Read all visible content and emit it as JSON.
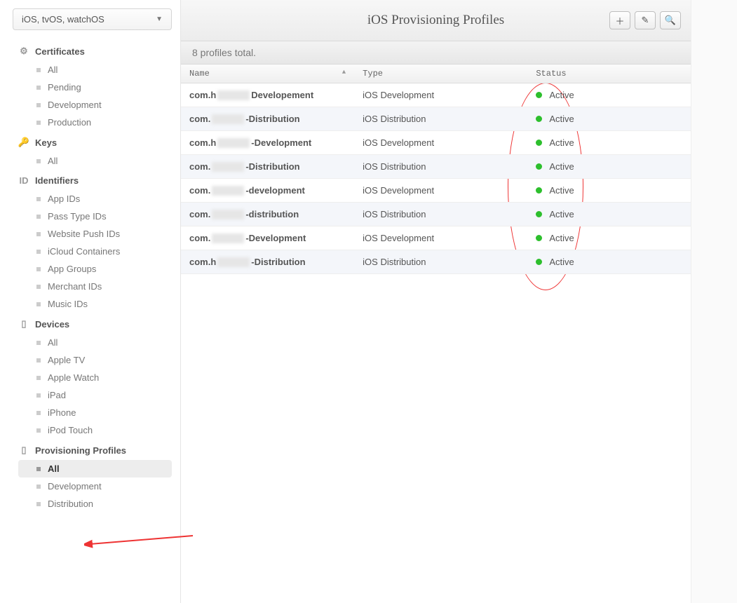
{
  "platform_selector": "iOS, tvOS, watchOS",
  "page_title": "iOS Provisioning Profiles",
  "summary": "8 profiles total.",
  "columns": {
    "name": "Name",
    "type": "Type",
    "status": "Status"
  },
  "sidebar": [
    {
      "title": "Certificates",
      "icon": "gear",
      "items": [
        "All",
        "Pending",
        "Development",
        "Production"
      ]
    },
    {
      "title": "Keys",
      "icon": "key",
      "items": [
        "All"
      ]
    },
    {
      "title": "Identifiers",
      "icon": "id",
      "items": [
        "App IDs",
        "Pass Type IDs",
        "Website Push IDs",
        "iCloud Containers",
        "App Groups",
        "Merchant IDs",
        "Music IDs"
      ]
    },
    {
      "title": "Devices",
      "icon": "device",
      "items": [
        "All",
        "Apple TV",
        "Apple Watch",
        "iPad",
        "iPhone",
        "iPod Touch"
      ]
    },
    {
      "title": "Provisioning Profiles",
      "icon": "doc",
      "items": [
        "All",
        "Development",
        "Distribution"
      ],
      "active": "All"
    }
  ],
  "rows": [
    {
      "prefix": "com.h",
      "suffix": "Developement",
      "type": "iOS Development",
      "status": "Active"
    },
    {
      "prefix": "com.",
      "suffix": "-Distribution",
      "type": "iOS Distribution",
      "status": "Active"
    },
    {
      "prefix": "com.h",
      "suffix": "-Development",
      "type": "iOS Development",
      "status": "Active"
    },
    {
      "prefix": "com.",
      "suffix": "-Distribution",
      "type": "iOS Distribution",
      "status": "Active"
    },
    {
      "prefix": "com.",
      "suffix": "-development",
      "type": "iOS Development",
      "status": "Active"
    },
    {
      "prefix": "com.",
      "suffix": "-distribution",
      "type": "iOS Distribution",
      "status": "Active"
    },
    {
      "prefix": "com.",
      "suffix": "-Development",
      "type": "iOS Development",
      "status": "Active"
    },
    {
      "prefix": "com.h",
      "suffix": "-Distribution",
      "type": "iOS Distribution",
      "status": "Active"
    }
  ]
}
